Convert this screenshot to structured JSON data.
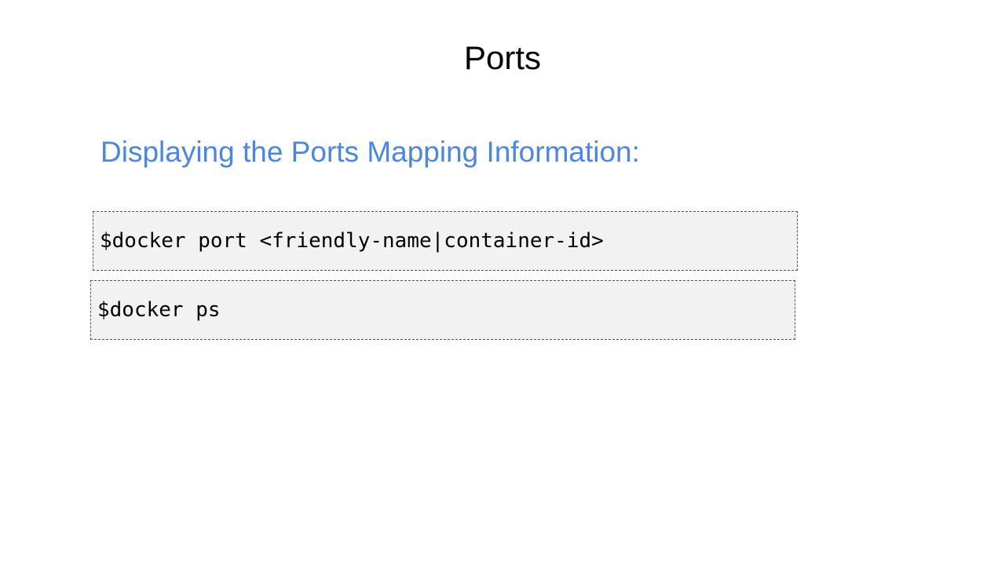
{
  "slide": {
    "title": "Ports",
    "subtitle": "Displaying the Ports Mapping Information:",
    "commands": [
      "$docker port <friendly-name|container-id>",
      "$docker ps"
    ]
  },
  "colors": {
    "subtitle": "#4a86e8",
    "code_background": "#f2f2f2",
    "code_border": "#555555"
  }
}
